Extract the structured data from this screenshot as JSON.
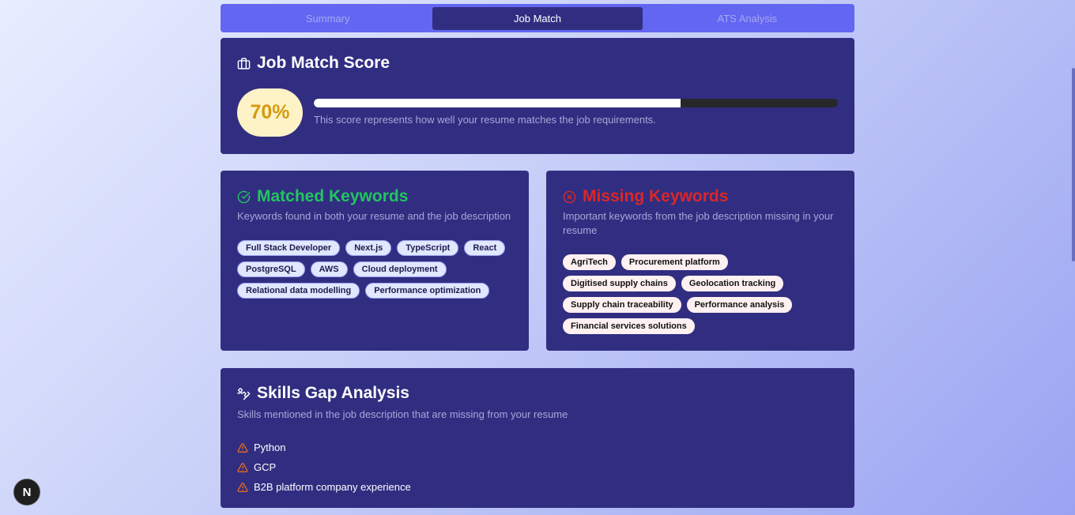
{
  "tabs": [
    "Summary",
    "Job Match",
    "ATS Analysis"
  ],
  "active_tab": "Job Match",
  "score_card": {
    "title": "Job Match Score",
    "score_label": "70%",
    "score_value": 70,
    "description": "This score represents how well your resume matches the job requirements."
  },
  "matched": {
    "title": "Matched Keywords",
    "subtitle": "Keywords found in both your resume and the job description",
    "keywords": [
      "Full Stack Developer",
      "Next.js",
      "TypeScript",
      "React",
      "PostgreSQL",
      "AWS",
      "Cloud deployment",
      "Relational data modelling",
      "Performance optimization"
    ]
  },
  "missing": {
    "title": "Missing Keywords",
    "subtitle": "Important keywords from the job description missing in your resume",
    "keywords": [
      "AgriTech",
      "Procurement platform",
      "Digitised supply chains",
      "Geolocation tracking",
      "Supply chain traceability",
      "Performance analysis",
      "Financial services solutions"
    ]
  },
  "skills": {
    "title": "Skills Gap Analysis",
    "subtitle": "Skills mentioned in the job description that are missing from your resume",
    "items": [
      "Python",
      "GCP",
      "B2B platform company experience"
    ]
  },
  "badge": "N",
  "colors": {
    "card_bg": "#312e81",
    "tab_bar": "#6366f1",
    "matched_accent": "#22c55e",
    "missing_accent": "#dc2626",
    "warning_accent": "#f97316",
    "score_bg": "#fef3c7",
    "score_text": "#d59a10"
  }
}
